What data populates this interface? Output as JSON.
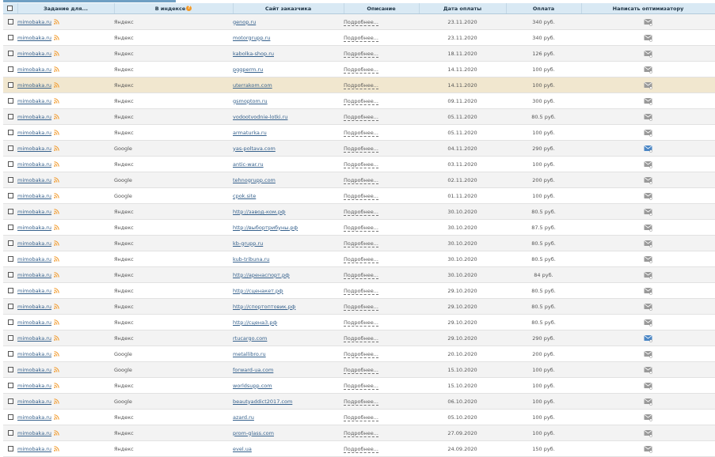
{
  "header": {
    "task": "Задание для...",
    "index": "В индексе",
    "index_help": "?",
    "site": "Сайт заказчика",
    "description": "Описание",
    "paydate": "Дата оплаты",
    "payment": "Оплата",
    "write": "Написать оптимизатору"
  },
  "rows": [
    {
      "task": "mimobaka.ru",
      "index": "Яндекс",
      "site": "genop.ru",
      "desc": "Подробнее...",
      "date": "23.11.2020",
      "pay": "340 руб.",
      "mail": "gray"
    },
    {
      "task": "mimobaka.ru",
      "index": "Яндекс",
      "site": "motorgrupp.ru",
      "desc": "Подробнее...",
      "date": "23.11.2020",
      "pay": "340 руб.",
      "mail": "gray"
    },
    {
      "task": "mimobaka.ru",
      "index": "Яндекс",
      "site": "kabolka-shop.ru",
      "desc": "Подробнее...",
      "date": "18.11.2020",
      "pay": "126 руб.",
      "mail": "gray"
    },
    {
      "task": "mimobaka.ru",
      "index": "Яндекс",
      "site": "pggperm.ru",
      "desc": "Подробнее...",
      "date": "14.11.2020",
      "pay": "100 руб.",
      "mail": "gray"
    },
    {
      "task": "mimobaka.ru",
      "index": "Яндекс",
      "site": "uterrakom.com",
      "desc": "Подробнее...",
      "date": "14.11.2020",
      "pay": "100 руб.",
      "mail": "gray"
    },
    {
      "task": "mimobaka.ru",
      "index": "Яндекс",
      "site": "gsmoptom.ru",
      "desc": "Подробнее...",
      "date": "09.11.2020",
      "pay": "300 руб.",
      "mail": "gray"
    },
    {
      "task": "mimobaka.ru",
      "index": "Яндекс",
      "site": "vodootvodnie-lotki.ru",
      "desc": "Подробнее...",
      "date": "05.11.2020",
      "pay": "80.5 руб.",
      "mail": "gray"
    },
    {
      "task": "mimobaka.ru",
      "index": "Яндекс",
      "site": "armaturka.ru",
      "desc": "Подробнее...",
      "date": "05.11.2020",
      "pay": "100 руб.",
      "mail": "gray"
    },
    {
      "task": "mimobaka.ru",
      "index": "Google",
      "site": "yas-poltava.com",
      "desc": "Подробнее...",
      "date": "04.11.2020",
      "pay": "290 руб.",
      "mail": "blue"
    },
    {
      "task": "mimobaka.ru",
      "index": "Яндекс",
      "site": "antic-war.ru",
      "desc": "Подробнее...",
      "date": "03.11.2020",
      "pay": "100 руб.",
      "mail": "gray"
    },
    {
      "task": "mimobaka.ru",
      "index": "Google",
      "site": "tehnogrupp.com",
      "desc": "Подробнее...",
      "date": "02.11.2020",
      "pay": "200 руб.",
      "mail": "gray"
    },
    {
      "task": "mimobaka.ru",
      "index": "Google",
      "site": "cpok.site",
      "desc": "Подробнее...",
      "date": "01.11.2020",
      "pay": "100 руб.",
      "mail": "gray"
    },
    {
      "task": "mimobaka.ru",
      "index": "Яндекс",
      "site": "http://завод-ком.рф",
      "desc": "Подробнее...",
      "date": "30.10.2020",
      "pay": "80.5 руб.",
      "mail": "gray"
    },
    {
      "task": "mimobaka.ru",
      "index": "Яндекс",
      "site": "http://выбортрибуны.рф",
      "desc": "Подробнее...",
      "date": "30.10.2020",
      "pay": "87.5 руб.",
      "mail": "gray"
    },
    {
      "task": "mimobaka.ru",
      "index": "Яндекс",
      "site": "kb-grupp.ru",
      "desc": "Подробнее...",
      "date": "30.10.2020",
      "pay": "80.5 руб.",
      "mail": "gray"
    },
    {
      "task": "mimobaka.ru",
      "index": "Яндекс",
      "site": "kub-tribuna.ru",
      "desc": "Подробнее...",
      "date": "30.10.2020",
      "pay": "80.5 руб.",
      "mail": "gray"
    },
    {
      "task": "mimobaka.ru",
      "index": "Яндекс",
      "site": "http://аренаспорт.рф",
      "desc": "Подробнее...",
      "date": "30.10.2020",
      "pay": "84 руб.",
      "mail": "gray"
    },
    {
      "task": "mimobaka.ru",
      "index": "Яндекс",
      "site": "http://сценакет.рф",
      "desc": "Подробнее...",
      "date": "29.10.2020",
      "pay": "80.5 руб.",
      "mail": "gray"
    },
    {
      "task": "mimobaka.ru",
      "index": "Яндекс",
      "site": "http://спортоптовик.рф",
      "desc": "Подробнее...",
      "date": "29.10.2020",
      "pay": "80.5 руб.",
      "mail": "gray"
    },
    {
      "task": "mimobaka.ru",
      "index": "Яндекс",
      "site": "http://сцена3.рф",
      "desc": "Подробнее...",
      "date": "29.10.2020",
      "pay": "80.5 руб.",
      "mail": "gray"
    },
    {
      "task": "mimobaka.ru",
      "index": "Яндекс",
      "site": "rtucargo.com",
      "desc": "Подробнее...",
      "date": "29.10.2020",
      "pay": "290 руб.",
      "mail": "blue"
    },
    {
      "task": "mimobaka.ru",
      "index": "Google",
      "site": "metallibro.ru",
      "desc": "Подробнее...",
      "date": "20.10.2020",
      "pay": "200 руб.",
      "mail": "gray"
    },
    {
      "task": "mimobaka.ru",
      "index": "Google",
      "site": "forward-ua.com",
      "desc": "Подробнее...",
      "date": "15.10.2020",
      "pay": "100 руб.",
      "mail": "gray"
    },
    {
      "task": "mimobaka.ru",
      "index": "Яндекс",
      "site": "worldsupp.com",
      "desc": "Подробнее...",
      "date": "15.10.2020",
      "pay": "100 руб.",
      "mail": "gray"
    },
    {
      "task": "mimobaka.ru",
      "index": "Google",
      "site": "beautyaddict2017.com",
      "desc": "Подробнее...",
      "date": "06.10.2020",
      "pay": "100 руб.",
      "mail": "gray"
    },
    {
      "task": "mimobaka.ru",
      "index": "Яндекс",
      "site": "azard.ru",
      "desc": "Подробнее...",
      "date": "05.10.2020",
      "pay": "100 руб.",
      "mail": "gray"
    },
    {
      "task": "mimobaka.ru",
      "index": "Яндекс",
      "site": "prom-glass.com",
      "desc": "Подробнее...",
      "date": "27.09.2020",
      "pay": "100 руб.",
      "mail": "gray"
    },
    {
      "task": "mimobaka.ru",
      "index": "Яндекс",
      "site": "evel.ua",
      "desc": "Подробнее...",
      "date": "24.09.2020",
      "pay": "150 руб.",
      "mail": "gray"
    }
  ],
  "highlight_row": 4,
  "colors": {
    "header_bg": "#d9e9f4",
    "link": "#37628d",
    "row_alt": "#f3f3f3",
    "row_highlight": "#f1e7cf",
    "rss": "#f29a2b",
    "mail_blue": "#4a86c5",
    "mail_gray": "#9a9a9a"
  }
}
